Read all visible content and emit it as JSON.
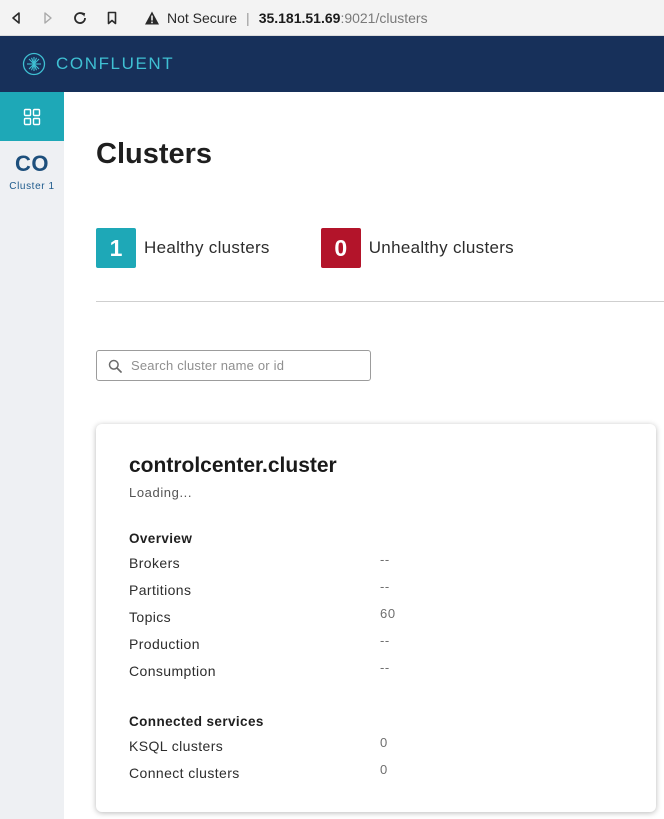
{
  "browser": {
    "security_label": "Not Secure",
    "separator": "|",
    "url_host": "35.181.51.69",
    "url_rest": ":9021/clusters"
  },
  "header": {
    "brand": "CONFLUENT",
    "bg_color": "#17305a",
    "brand_color": "#3fc0d3"
  },
  "sidebar": {
    "cluster_abbr": "CO",
    "cluster_name": "Cluster 1"
  },
  "main": {
    "title": "Clusters",
    "health": [
      {
        "count": "1",
        "label": "Healthy clusters",
        "color": "#1ea8b7"
      },
      {
        "count": "0",
        "label": "Unhealthy clusters",
        "color": "#b3142a"
      }
    ],
    "search": {
      "placeholder": "Search cluster name or id"
    },
    "card": {
      "title": "controlcenter.cluster",
      "status": "Loading...",
      "overview": {
        "heading": "Overview",
        "rows": [
          {
            "label": "Brokers",
            "value": "--"
          },
          {
            "label": "Partitions",
            "value": "--"
          },
          {
            "label": "Topics",
            "value": "60"
          },
          {
            "label": "Production",
            "value": "--"
          },
          {
            "label": "Consumption",
            "value": "--"
          }
        ]
      },
      "services": {
        "heading": "Connected services",
        "rows": [
          {
            "label": "KSQL clusters",
            "value": "0"
          },
          {
            "label": "Connect clusters",
            "value": "0"
          }
        ]
      }
    }
  }
}
